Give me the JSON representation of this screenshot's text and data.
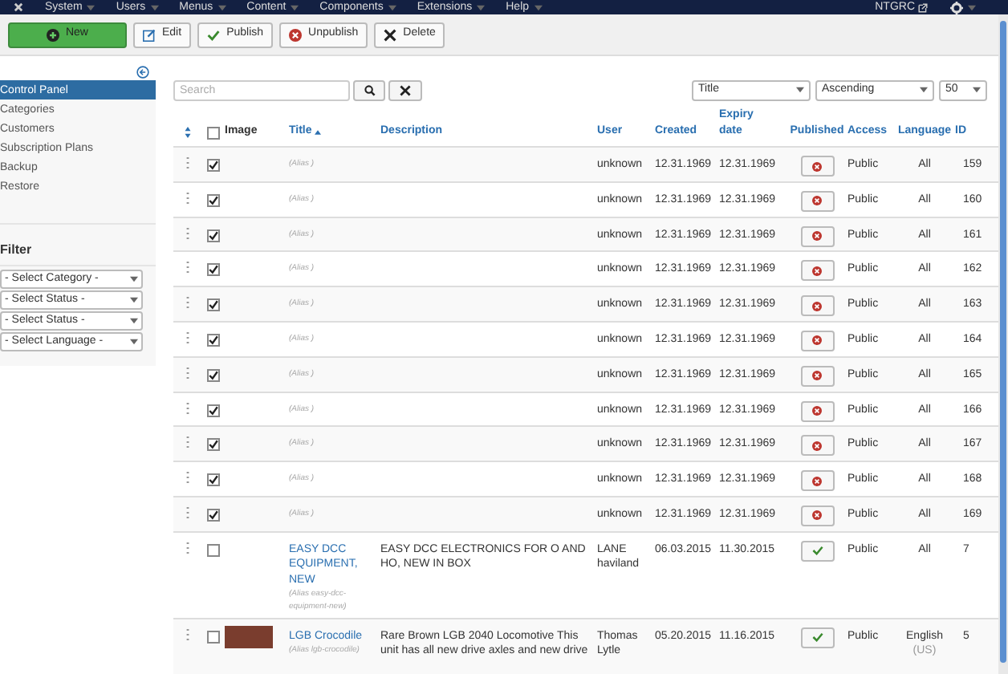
{
  "navbar": {
    "menus": [
      "System",
      "Users",
      "Menus",
      "Content",
      "Components",
      "Extensions",
      "Help"
    ],
    "site": "NTGRC"
  },
  "toolbar": [
    {
      "kind": "new",
      "label": "New"
    },
    {
      "kind": "edit",
      "label": "Edit"
    },
    {
      "kind": "publish",
      "label": "Publish"
    },
    {
      "kind": "unpublish",
      "label": "Unpublish"
    },
    {
      "kind": "delete",
      "label": "Delete"
    }
  ],
  "sidebar": {
    "items": [
      {
        "label": "Control Panel",
        "selected": true
      },
      {
        "label": "Categories",
        "selected": false
      },
      {
        "label": "Customers",
        "selected": false
      },
      {
        "label": "Subscription Plans",
        "selected": false
      },
      {
        "label": "Backup",
        "selected": false
      },
      {
        "label": "Restore",
        "selected": false
      }
    ],
    "filter_title": "Filter",
    "filters": [
      "- Select Category -",
      "- Select Status -",
      "- Select Status -",
      "- Select Language -"
    ]
  },
  "search": {
    "placeholder": "Search"
  },
  "sort": {
    "field": "Title",
    "direction": "Ascending",
    "limit": "50"
  },
  "table": {
    "select_all_checked": false,
    "columns": [
      "Image",
      "Title",
      "Description",
      "User",
      "Created",
      "Expiry date",
      "Published",
      "Access",
      "Language",
      "ID"
    ],
    "rows": [
      {
        "checked": true,
        "image": false,
        "title": "",
        "alias": "(Alias )",
        "description": "",
        "user": "unknown",
        "created": "12.31.1969",
        "expiry": "12.31.1969",
        "published": false,
        "access": "Public",
        "language": "All",
        "language_note": "",
        "id": "159"
      },
      {
        "checked": true,
        "image": false,
        "title": "",
        "alias": "(Alias )",
        "description": "",
        "user": "unknown",
        "created": "12.31.1969",
        "expiry": "12.31.1969",
        "published": false,
        "access": "Public",
        "language": "All",
        "language_note": "",
        "id": "160"
      },
      {
        "checked": true,
        "image": false,
        "title": "",
        "alias": "(Alias )",
        "description": "",
        "user": "unknown",
        "created": "12.31.1969",
        "expiry": "12.31.1969",
        "published": false,
        "access": "Public",
        "language": "All",
        "language_note": "",
        "id": "161"
      },
      {
        "checked": true,
        "image": false,
        "title": "",
        "alias": "(Alias )",
        "description": "",
        "user": "unknown",
        "created": "12.31.1969",
        "expiry": "12.31.1969",
        "published": false,
        "access": "Public",
        "language": "All",
        "language_note": "",
        "id": "162"
      },
      {
        "checked": true,
        "image": false,
        "title": "",
        "alias": "(Alias )",
        "description": "",
        "user": "unknown",
        "created": "12.31.1969",
        "expiry": "12.31.1969",
        "published": false,
        "access": "Public",
        "language": "All",
        "language_note": "",
        "id": "163"
      },
      {
        "checked": true,
        "image": false,
        "title": "",
        "alias": "(Alias )",
        "description": "",
        "user": "unknown",
        "created": "12.31.1969",
        "expiry": "12.31.1969",
        "published": false,
        "access": "Public",
        "language": "All",
        "language_note": "",
        "id": "164"
      },
      {
        "checked": true,
        "image": false,
        "title": "",
        "alias": "(Alias )",
        "description": "",
        "user": "unknown",
        "created": "12.31.1969",
        "expiry": "12.31.1969",
        "published": false,
        "access": "Public",
        "language": "All",
        "language_note": "",
        "id": "165"
      },
      {
        "checked": true,
        "image": false,
        "title": "",
        "alias": "(Alias )",
        "description": "",
        "user": "unknown",
        "created": "12.31.1969",
        "expiry": "12.31.1969",
        "published": false,
        "access": "Public",
        "language": "All",
        "language_note": "",
        "id": "166"
      },
      {
        "checked": true,
        "image": false,
        "title": "",
        "alias": "(Alias )",
        "description": "",
        "user": "unknown",
        "created": "12.31.1969",
        "expiry": "12.31.1969",
        "published": false,
        "access": "Public",
        "language": "All",
        "language_note": "",
        "id": "167"
      },
      {
        "checked": true,
        "image": false,
        "title": "",
        "alias": "(Alias )",
        "description": "",
        "user": "unknown",
        "created": "12.31.1969",
        "expiry": "12.31.1969",
        "published": false,
        "access": "Public",
        "language": "All",
        "language_note": "",
        "id": "168"
      },
      {
        "checked": true,
        "image": false,
        "title": "",
        "alias": "(Alias )",
        "description": "",
        "user": "unknown",
        "created": "12.31.1969",
        "expiry": "12.31.1969",
        "published": false,
        "access": "Public",
        "language": "All",
        "language_note": "",
        "id": "169"
      },
      {
        "checked": false,
        "image": false,
        "title": "EASY DCC EQUIPMENT, NEW",
        "alias": "(Alias easy-dcc-equipment-new)",
        "description": "EASY DCC ELECTRONICS FOR O AND HO, NEW IN BOX",
        "user": "LANE haviland",
        "created": "06.03.2015",
        "expiry": "11.30.2015",
        "published": true,
        "access": "Public",
        "language": "All",
        "language_note": "",
        "id": "7"
      },
      {
        "checked": false,
        "image": true,
        "title": "LGB Crocodile",
        "alias": "(Alias lgb-crocodile)",
        "description": "Rare Brown LGB 2040 Locomotive This unit has all new drive axles and new drive",
        "user": "Thomas Lytle",
        "created": "05.20.2015",
        "expiry": "11.16.2015",
        "published": true,
        "access": "Public",
        "language": "English",
        "language_note": "(US)",
        "id": "5"
      }
    ]
  }
}
